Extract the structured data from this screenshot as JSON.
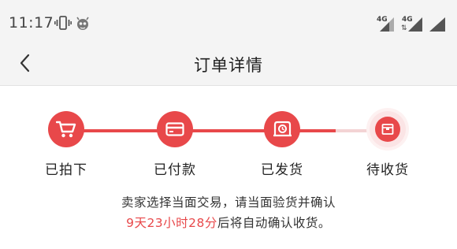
{
  "status_bar": {
    "time": "11:17",
    "network_1": "4G",
    "network_2": "4G",
    "icons": [
      "vibrate-icon",
      "bug-icon",
      "signal-icon",
      "signal-icon",
      "signal-icon"
    ]
  },
  "nav": {
    "title": "订单详情",
    "back_icon": "chevron-left-icon"
  },
  "progress": {
    "accent_color": "#e8484a",
    "steps": [
      {
        "label": "已拍下",
        "icon": "cart-icon",
        "state": "done"
      },
      {
        "label": "已付款",
        "icon": "card-icon",
        "state": "done"
      },
      {
        "label": "已发货",
        "icon": "delivery-icon",
        "state": "done"
      },
      {
        "label": "待收货",
        "icon": "package-icon",
        "state": "pending"
      }
    ]
  },
  "notice": {
    "line1": "卖家选择当面交易，请当面验货并确认",
    "countdown": "9天23小时28分",
    "line2_suffix": "后将自动确认收货。"
  }
}
